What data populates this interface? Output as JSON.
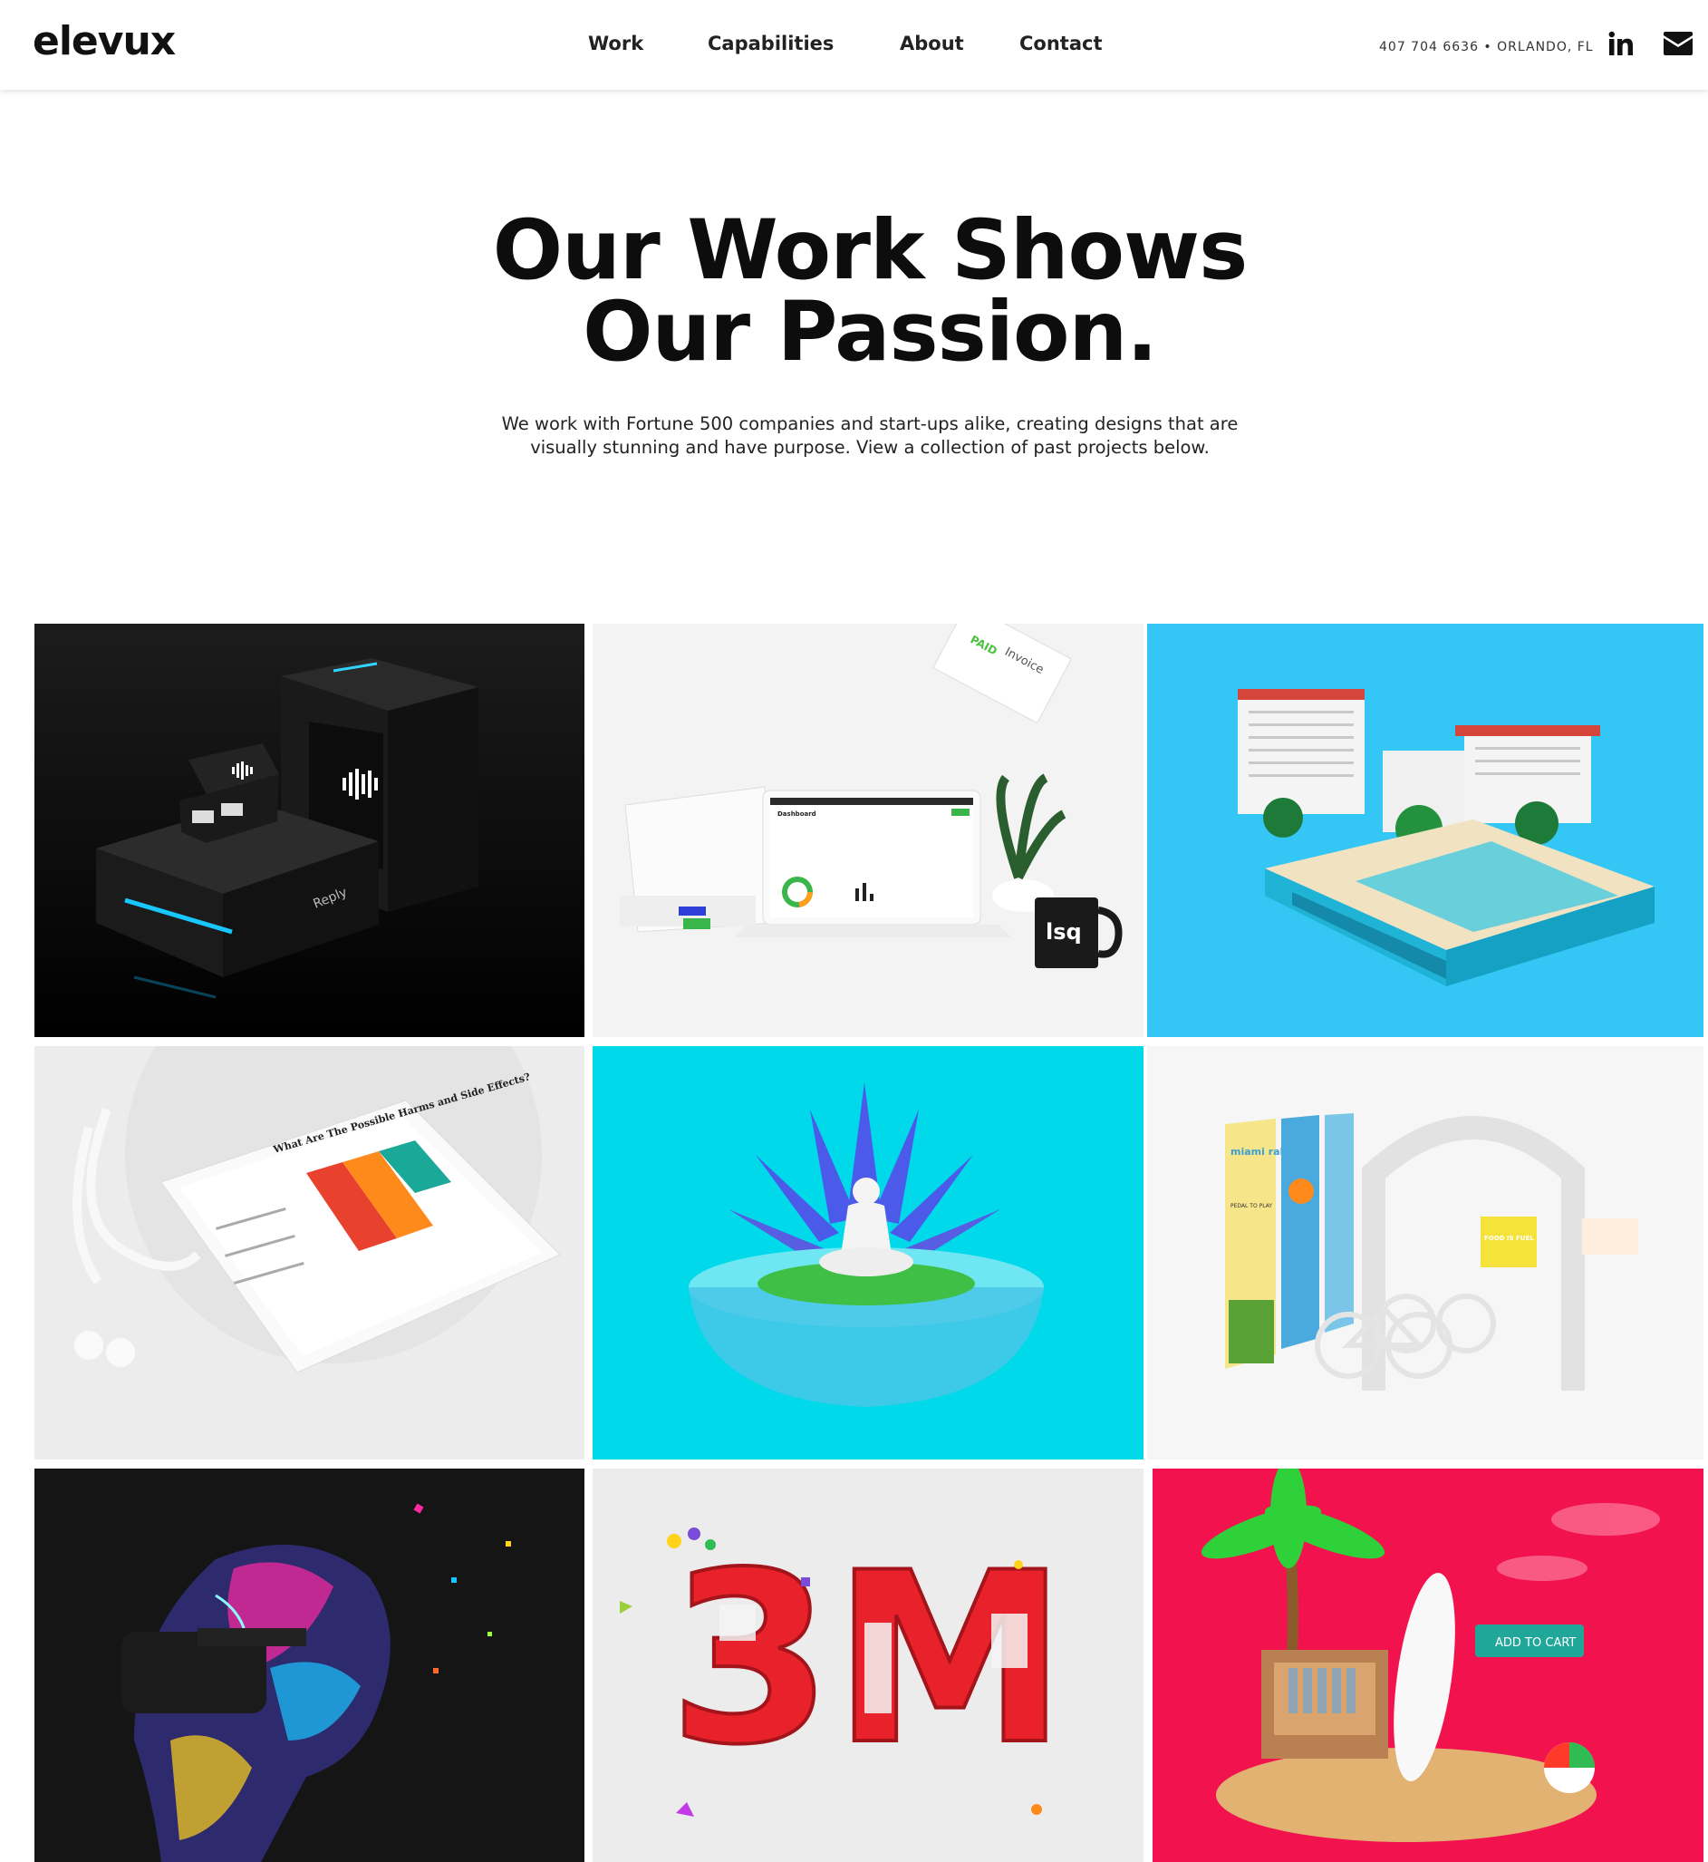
{
  "brand": {
    "logo": "elevux"
  },
  "nav": {
    "items": [
      "Work",
      "Capabilities",
      "About",
      "Contact"
    ]
  },
  "contact": {
    "info": "407 704 6636 • ORLANDO, FL"
  },
  "social": {
    "icons": [
      "linkedin-icon",
      "envelope-icon"
    ]
  },
  "hero": {
    "title_line1": "Our Work Shows",
    "title_line2": "Our Passion.",
    "subtitle_line1": "We work with Fortune 500 companies and start-ups alike, creating designs that are",
    "subtitle_line2": "visually stunning and have purpose. View a collection of past projects below."
  },
  "portfolio": {
    "tiles": [
      {
        "name": "reply-product-box",
        "background": "#0a0a0a",
        "text": "Reply"
      },
      {
        "name": "lsq-dashboard",
        "background": "#f2f2f2",
        "text": "lsq",
        "dashboard_title": "Dashboard",
        "invoice_text": "Invoice",
        "stamp_text": "PAID"
      },
      {
        "name": "resort-island",
        "background": "#34c6f4"
      },
      {
        "name": "medical-tablet",
        "background": "#ececec",
        "heading": "What Are The Possible Harms and Side Effects?"
      },
      {
        "name": "meditation-lotus",
        "background": "#00d9ea"
      },
      {
        "name": "miami-rally-exhibit",
        "background": "#f4f4f4",
        "poster_title": "miami rally",
        "poster_sub": "PEDAL TO PLAY",
        "screen_text": "FOOD IS FUEL"
      },
      {
        "name": "vr-headset-art",
        "background": "#151515"
      },
      {
        "name": "3m-letters",
        "background": "#ececec",
        "text": "3M"
      },
      {
        "name": "beach-shop-cart",
        "background": "#f2134e",
        "button_text": "ADD TO CART"
      }
    ]
  },
  "colors": {
    "accent_cyan": "#00d9ea",
    "accent_blue": "#34c6f4",
    "accent_pink": "#f2134e"
  }
}
